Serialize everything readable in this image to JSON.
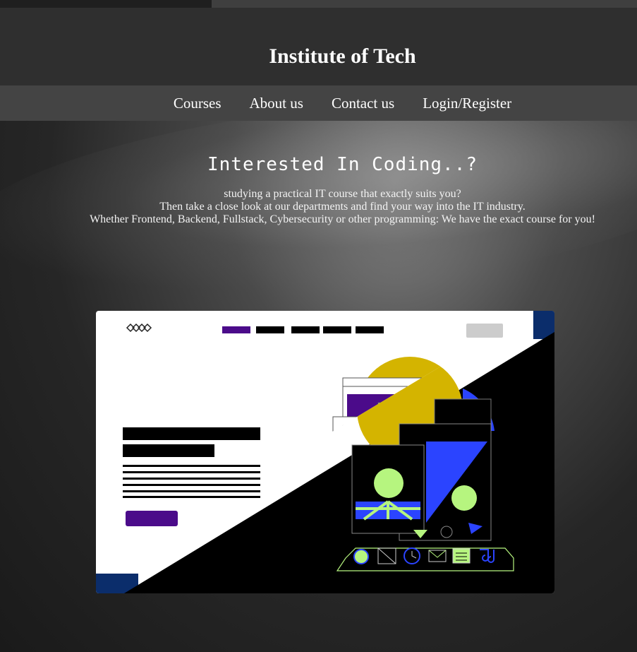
{
  "header": {
    "title": "Institute of Tech"
  },
  "nav": {
    "items": [
      {
        "label": "Courses"
      },
      {
        "label": "About us"
      },
      {
        "label": "Contact us"
      },
      {
        "label": "Login/Register"
      }
    ]
  },
  "hero": {
    "heading": "Interested In Coding..?",
    "lines": [
      "studying a practical IT course that exactly suits you?",
      "Then take a close look at our departments and find your way into the IT industry.",
      "Whether Frontend, Backend, Fullstack, Cybersecurity or other programming: We have the exact course for you!"
    ]
  },
  "illustration": {
    "icon": "website-mockup-illustration",
    "colors": {
      "purple": "#4b0b8a",
      "navy": "#0b2d6b",
      "yellow": "#d4b400",
      "blue": "#2b44ff",
      "lime": "#b6f57f"
    }
  }
}
